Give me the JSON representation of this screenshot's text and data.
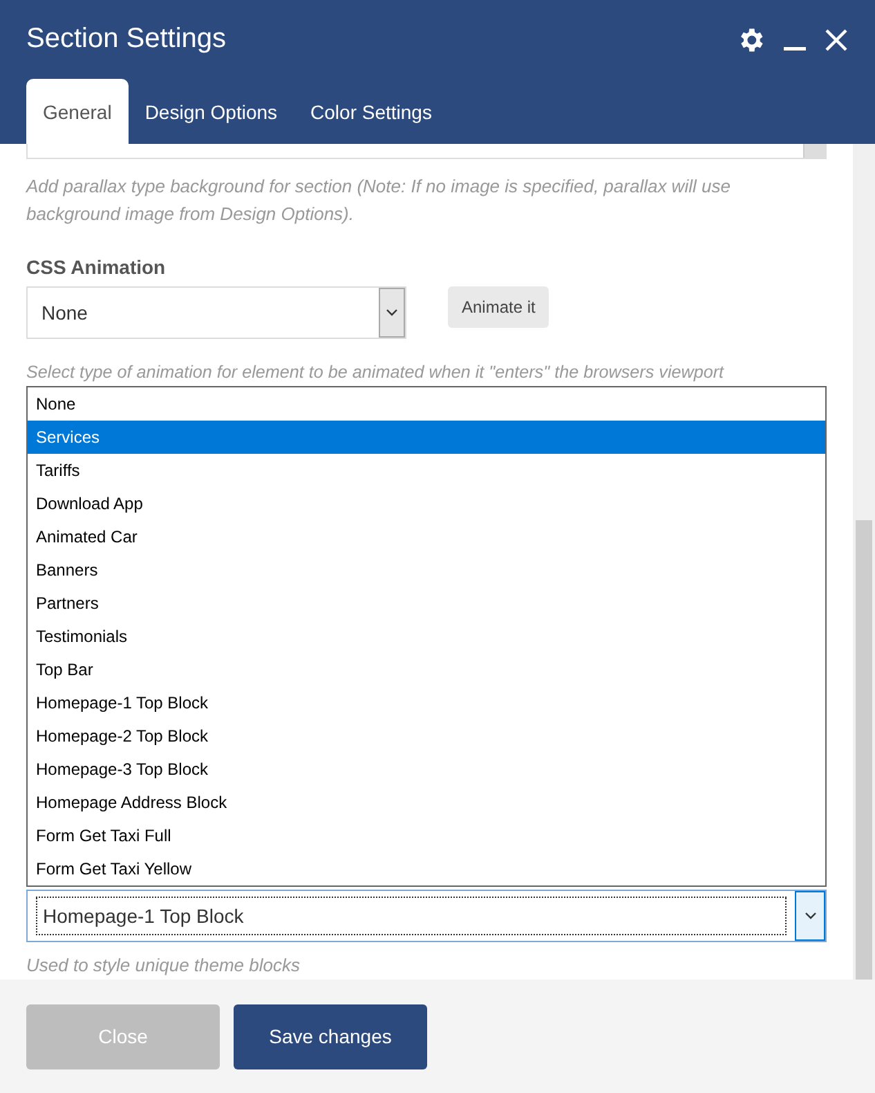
{
  "window": {
    "title": "Section Settings"
  },
  "tabs": [
    {
      "label": "General",
      "selected": true
    },
    {
      "label": "Design Options",
      "selected": false
    },
    {
      "label": "Color Settings",
      "selected": false
    }
  ],
  "parallax_note": "Add parallax type background for section (Note: If no image is specified, parallax will use background image from Design Options).",
  "css_animation": {
    "label": "CSS Animation",
    "value": "None",
    "button": "Animate it",
    "note": "Select type of animation for element to be animated when it \"enters\" the browsers viewport"
  },
  "options": [
    {
      "label": "None",
      "selected": false
    },
    {
      "label": "Services",
      "selected": true
    },
    {
      "label": "Tariffs",
      "selected": false
    },
    {
      "label": "Download App",
      "selected": false
    },
    {
      "label": "Animated Car",
      "selected": false
    },
    {
      "label": "Banners",
      "selected": false
    },
    {
      "label": "Partners",
      "selected": false
    },
    {
      "label": "Testimonials",
      "selected": false
    },
    {
      "label": "Top Bar",
      "selected": false
    },
    {
      "label": "Homepage-1 Top Block",
      "selected": false
    },
    {
      "label": "Homepage-2 Top Block",
      "selected": false
    },
    {
      "label": "Homepage-3 Top Block",
      "selected": false
    },
    {
      "label": "Homepage Address Block",
      "selected": false
    },
    {
      "label": "Form Get Taxi Full",
      "selected": false
    },
    {
      "label": "Form Get Taxi Yellow",
      "selected": false
    }
  ],
  "block_select": {
    "value": "Homepage-1 Top Block",
    "note": "Used to style unique theme blocks"
  },
  "buttons": {
    "close": "Close",
    "save": "Save changes"
  }
}
